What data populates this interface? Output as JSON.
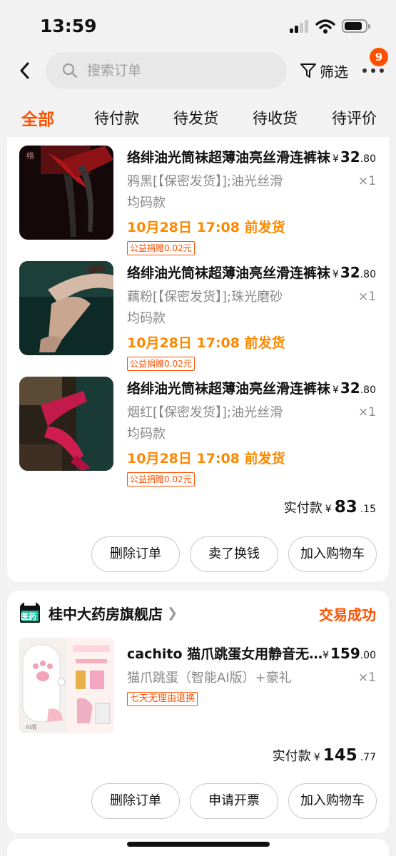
{
  "status_bar": {
    "time": "13:59"
  },
  "header": {
    "search_placeholder": "搜索订单",
    "filter_label": "筛选",
    "more_badge": "9"
  },
  "tabs": [
    "全部",
    "待付款",
    "待发货",
    "待收货",
    "待评价"
  ],
  "orders": [
    {
      "items": [
        {
          "title": "络绯油光筒袜超薄油亮丝滑连裤袜",
          "price_int": "32",
          "price_dec": ".80",
          "currency": "¥",
          "sku_line1": "鸦黑[【保密发货】];油光丝滑",
          "sku_line2": "均码款",
          "qty": "×1",
          "ship": "10月28日 17:08 前发货",
          "tag": "公益捐赠0.02元"
        },
        {
          "title": "络绯油光筒袜超薄油亮丝滑连裤袜",
          "price_int": "32",
          "price_dec": ".80",
          "currency": "¥",
          "sku_line1": "藕粉[【保密发货】];珠光磨砂",
          "sku_line2": "均码款",
          "qty": "×1",
          "ship": "10月28日 17:08 前发货",
          "tag": "公益捐赠0.02元"
        },
        {
          "title": "络绯油光筒袜超薄油亮丝滑连裤袜",
          "price_int": "32",
          "price_dec": ".80",
          "currency": "¥",
          "sku_line1": "烟红[【保密发货】];油光丝滑",
          "sku_line2": "均码款",
          "qty": "×1",
          "ship": "10月28日 17:08 前发货",
          "tag": "公益捐赠0.02元"
        }
      ],
      "paid_label": "实付款",
      "paid_currency": "¥",
      "paid_int": "83",
      "paid_dec": ".15",
      "buttons": [
        "删除订单",
        "卖了换钱",
        "加入购物车"
      ]
    },
    {
      "shop_name": "桂中大药房旗舰店",
      "shop_logo_text": "医药",
      "status": "交易成功",
      "items": [
        {
          "title": "cachito 猫爪跳蛋女用静音无线遥控",
          "price_int": "159",
          "price_dec": ".00",
          "currency": "¥",
          "sku_line1": "猫爪跳蛋（智能AI版）+豪礼",
          "qty": "×1",
          "tag": "七天无理由退换"
        }
      ],
      "paid_label": "实付款",
      "paid_currency": "¥",
      "paid_int": "145",
      "paid_dec": ".77",
      "buttons": [
        "删除订单",
        "申请开票",
        "加入购物车"
      ]
    }
  ],
  "colors": {
    "accent": "#ff5000",
    "ship_orange": "#ff8800"
  }
}
